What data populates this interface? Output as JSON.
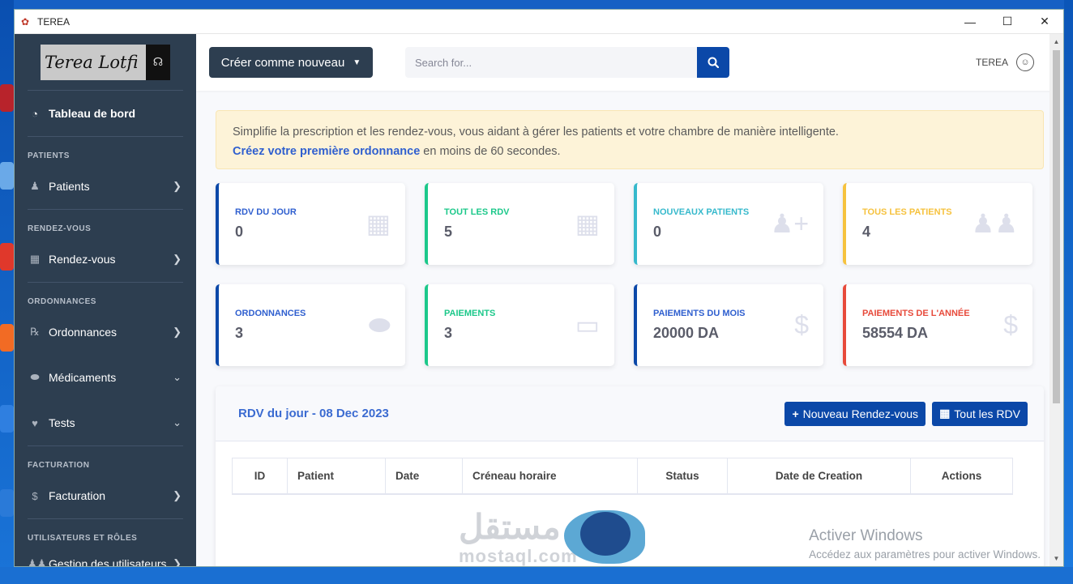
{
  "window": {
    "title": "TEREA",
    "minimize": "—",
    "maximize": "☐",
    "close": "✕"
  },
  "sidebar": {
    "brand": "Terea Lotfi",
    "dashboard": "Tableau de bord",
    "sections": {
      "patients": "PATIENTS",
      "rdv": "RENDEZ-VOUS",
      "ordonnances": "ORDONNANCES",
      "facturation": "FACTURATION",
      "users": "UTILISATEURS ET RÔLES"
    },
    "items": {
      "patients": "Patients",
      "rdv": "Rendez-vous",
      "ordonnances": "Ordonnances",
      "medicaments": "Médicaments",
      "tests": "Tests",
      "facturation": "Facturation",
      "users": "Gestion des utilisateurs"
    }
  },
  "topbar": {
    "create_label": "Créer comme nouveau",
    "search_placeholder": "Search for...",
    "user_name": "TEREA"
  },
  "alert": {
    "line1": "Simplifie la prescription et les rendez-vous, vous aidant à gérer les patients et votre chambre de manière intelligente.",
    "link": "Créez votre première ordonnance",
    "line2_rest": " en moins de 60 secondes."
  },
  "cards": [
    {
      "label": "RDV DU JOUR",
      "value": "0",
      "color": "#0b48a8",
      "icon": "calendar-check-icon"
    },
    {
      "label": "TOUT LES RDV",
      "value": "5",
      "color": "#1cc88a",
      "icon": "calendar-icon"
    },
    {
      "label": "NOUVEAUX PATIENTS",
      "value": "0",
      "color": "#36b9cc",
      "icon": "user-plus-icon"
    },
    {
      "label": "TOUS LES PATIENTS",
      "value": "4",
      "color": "#f6c23e",
      "icon": "users-icon"
    },
    {
      "label": "ORDONNANCES",
      "value": "3",
      "color": "#0b48a8",
      "icon": "pills-icon"
    },
    {
      "label": "PAIEMENTS",
      "value": "3",
      "color": "#1cc88a",
      "icon": "wallet-icon"
    },
    {
      "label": "PAIEMENTS DU MOIS",
      "value": "20000 DA",
      "color": "#0b48a8",
      "icon": "dollar-icon"
    },
    {
      "label": "PAIEMENTS DE L'ANNÉE",
      "value": "58554 DA",
      "color": "#e74a3b",
      "icon": "dollar-icon"
    }
  ],
  "panel": {
    "title": "RDV du jour - 08 Dec 2023",
    "new_btn": "Nouveau Rendez-vous",
    "all_btn": "Tout les RDV",
    "columns": [
      "ID",
      "Patient",
      "Date",
      "Créneau horaire",
      "Status",
      "Date de Creation",
      "Actions"
    ]
  },
  "watermark": {
    "title": "Activer Windows",
    "subtitle": "Accédez aux paramètres pour activer Windows."
  },
  "overlay": {
    "arabic": "مستقل",
    "latin": "mostaql.com"
  }
}
